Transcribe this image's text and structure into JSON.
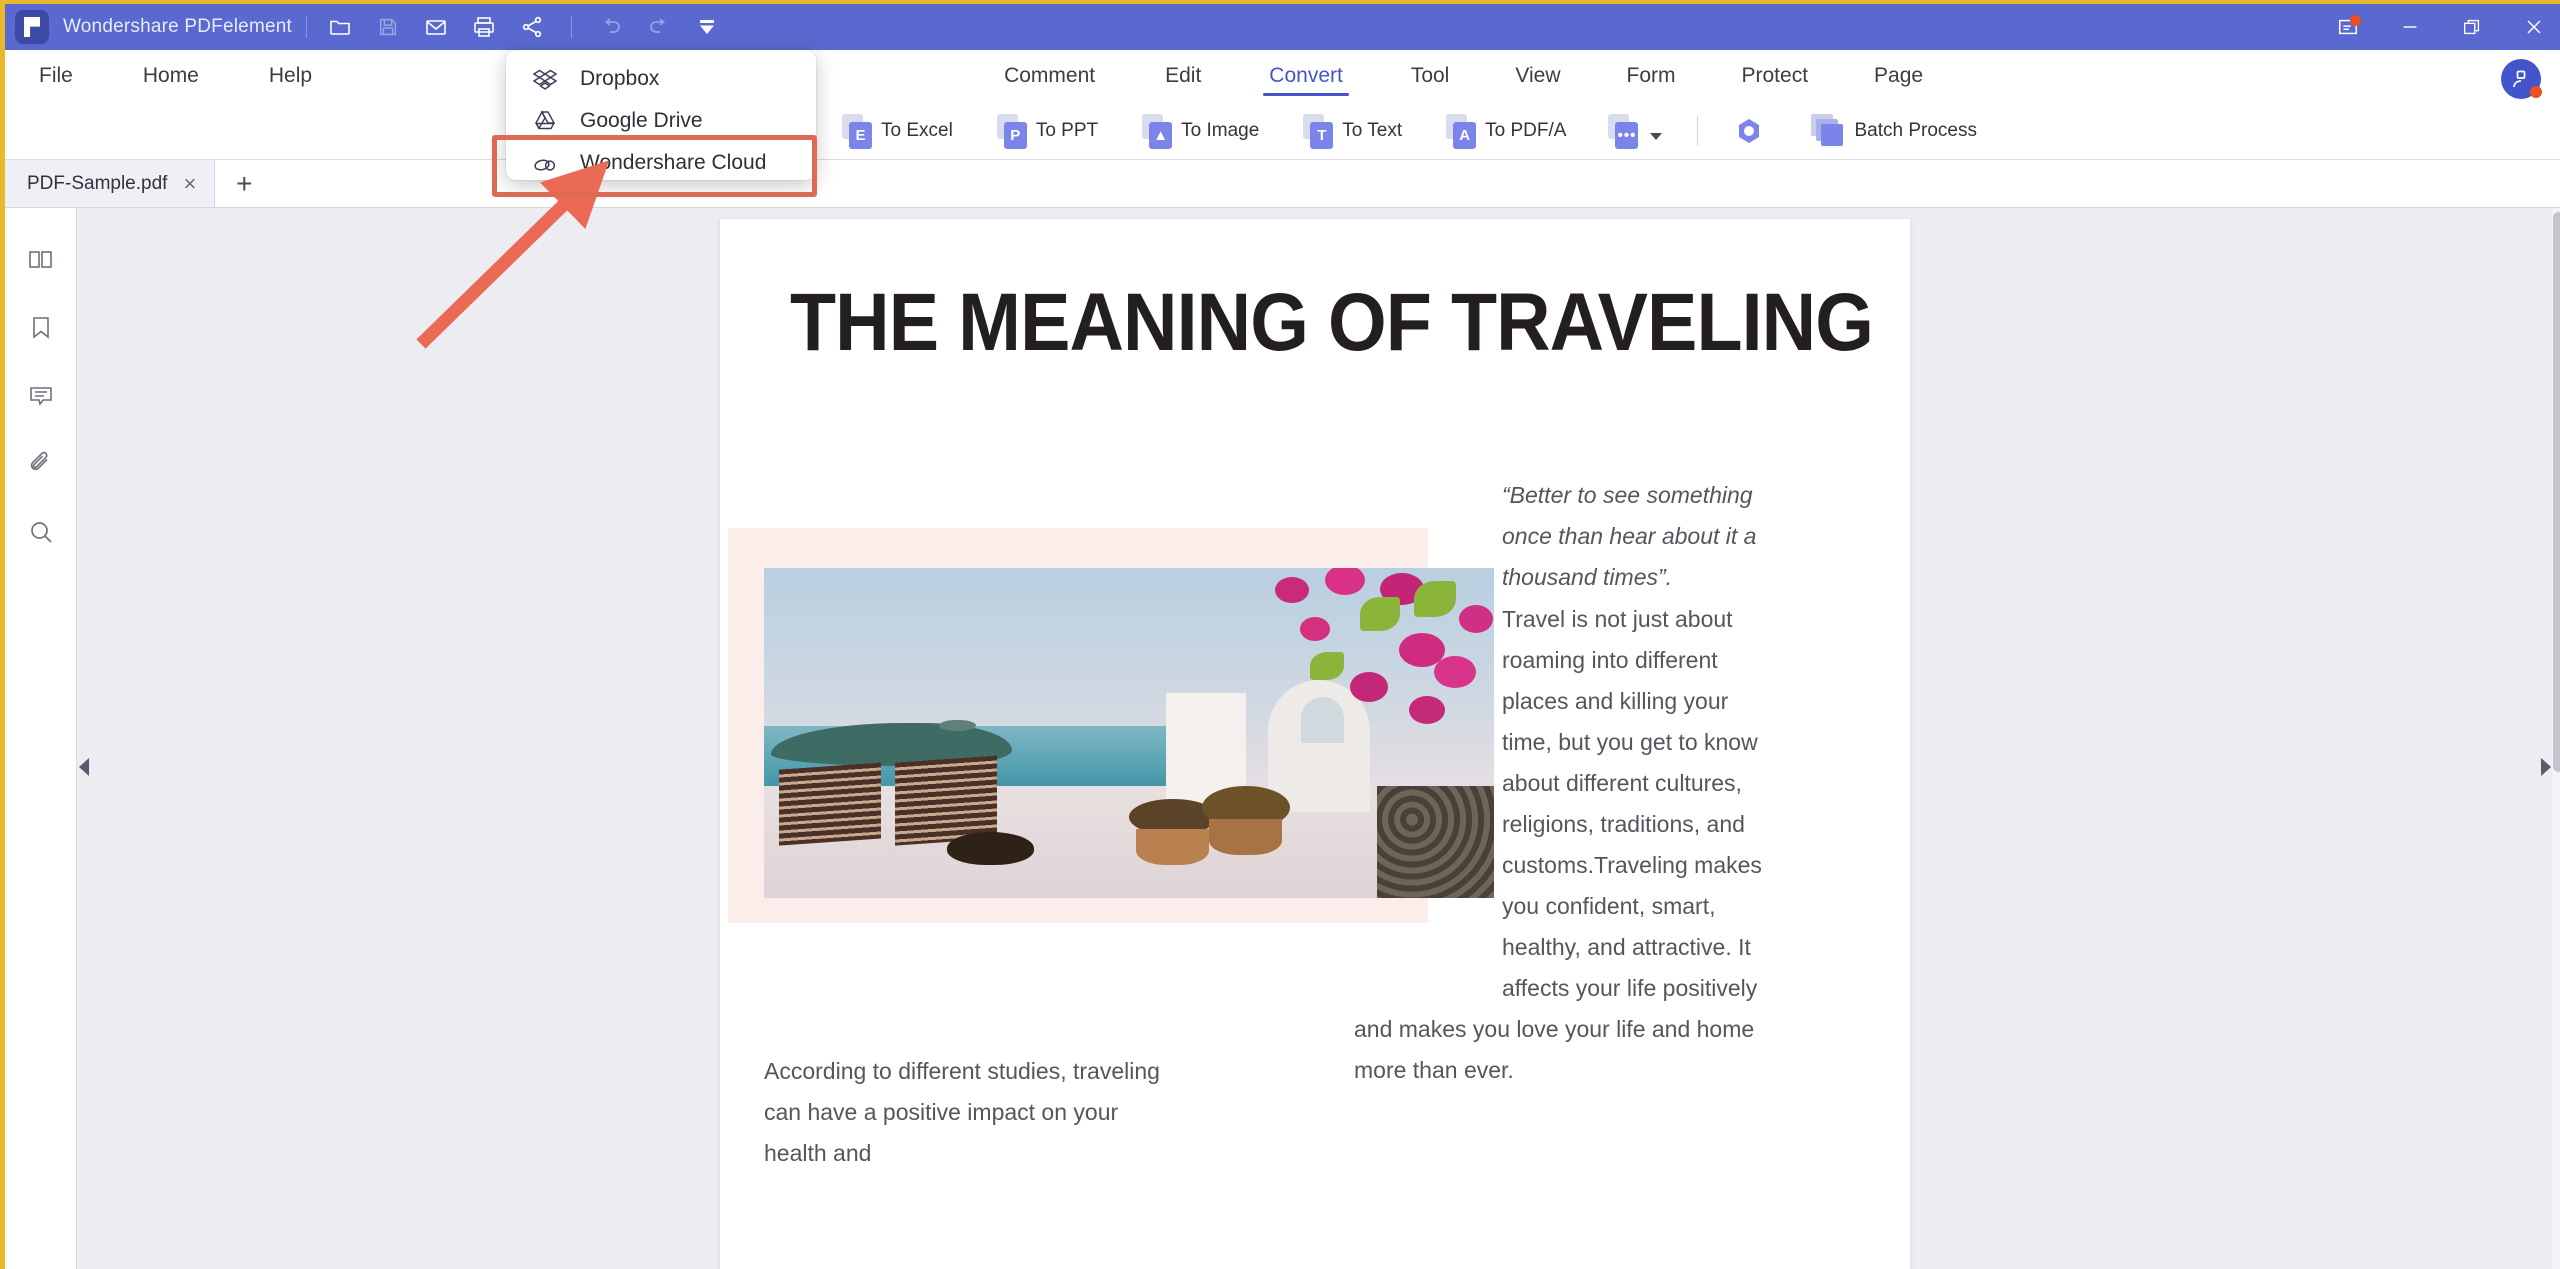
{
  "titlebar": {
    "app_name": "Wondershare PDFelement",
    "brand_color": "#5969cf",
    "accent_color": "#e8b92a",
    "quick_tools": [
      {
        "name": "open-folder-icon",
        "label": "Open"
      },
      {
        "name": "save-icon",
        "label": "Save"
      },
      {
        "name": "email-icon",
        "label": "Email"
      },
      {
        "name": "print-icon",
        "label": "Print"
      },
      {
        "name": "share-icon",
        "label": "Share"
      },
      {
        "name": "undo-icon",
        "label": "Undo"
      },
      {
        "name": "redo-icon",
        "label": "Redo"
      },
      {
        "name": "customize-icon",
        "label": "Customize Quick Access Toolbar"
      }
    ],
    "window_controls": [
      {
        "name": "notifications-icon",
        "label": "Notifications",
        "badge": true
      },
      {
        "name": "minimize-icon",
        "label": "Minimize"
      },
      {
        "name": "restore-icon",
        "label": "Restore"
      },
      {
        "name": "close-icon",
        "label": "Close"
      }
    ]
  },
  "ribbon": {
    "tabs": [
      {
        "label": "File",
        "active": false
      },
      {
        "label": "Home",
        "active": false
      },
      {
        "label": "Help",
        "active": false
      },
      {
        "label": "Comment",
        "active": false
      },
      {
        "label": "Edit",
        "active": false
      },
      {
        "label": "Convert",
        "active": true
      },
      {
        "label": "Tool",
        "active": false
      },
      {
        "label": "View",
        "active": false
      },
      {
        "label": "Form",
        "active": false
      },
      {
        "label": "Protect",
        "active": false
      },
      {
        "label": "Page",
        "active": false
      }
    ],
    "active_tab": "Convert",
    "active_color": "#4455cc",
    "account": {
      "name": "account-avatar",
      "label": "Account"
    }
  },
  "toolbar": {
    "buttons": [
      {
        "label": "To Excel",
        "glyph": "E",
        "icon": "to-excel-icon"
      },
      {
        "label": "To PPT",
        "glyph": "P",
        "icon": "to-ppt-icon"
      },
      {
        "label": "To Image",
        "glyph": "▲",
        "icon": "to-image-icon"
      },
      {
        "label": "To Text",
        "glyph": "T",
        "icon": "to-text-icon"
      },
      {
        "label": "To PDF/A",
        "glyph": "A",
        "icon": "to-pdfa-icon"
      }
    ],
    "more_button": {
      "label": "More conversions",
      "glyph": "•••",
      "icon": "more-convert-icon"
    },
    "ocr_button": {
      "label": "OCR",
      "icon": "ocr-icon"
    },
    "batch_button": {
      "label": "Batch Process",
      "icon": "batch-process-icon"
    }
  },
  "tabstrip": {
    "documents": [
      {
        "name": "PDF-Sample.pdf",
        "active": true
      }
    ],
    "close_label": "×",
    "add_label": "+"
  },
  "left_rail": {
    "items": [
      {
        "name": "thumbnails-panel-icon",
        "label": "Thumbnails"
      },
      {
        "name": "bookmark-panel-icon",
        "label": "Bookmarks"
      },
      {
        "name": "comment-panel-icon",
        "label": "Comments"
      },
      {
        "name": "attachment-panel-icon",
        "label": "Attachments"
      },
      {
        "name": "search-panel-icon",
        "label": "Search"
      }
    ]
  },
  "dropdown": {
    "visible": true,
    "items": [
      {
        "label": "Dropbox",
        "icon": "dropbox-icon",
        "highlighted": false
      },
      {
        "label": "Google Drive",
        "icon": "google-drive-icon",
        "highlighted": false
      },
      {
        "label": "Wondershare Cloud",
        "icon": "wondershare-cloud-icon",
        "highlighted": true
      }
    ]
  },
  "annotations": {
    "highlight_color": "#dd6a54",
    "arrow_color": "#ea6a55",
    "highlight_target": "Wondershare Cloud",
    "arrow_points_to": "Wondershare Cloud"
  },
  "document": {
    "title": "THE MEANING OF TRAVELING",
    "quote": "“Better to see something once than hear about it a thousand times”.",
    "paragraph_1_narrow": "Travel is not just about roaming into different places and killing your time, but you get to know about different cultures, religions, traditions, and customs.Traveling makes you confident, smart, healthy, and attractive. It affects your life positively",
    "paragraph_1_wide": "and makes you love your life and home more than ever.",
    "paragraph_2": "According to different studies, traveling can have a positive impact on your health and",
    "photo_alt": "Santorini terrace overlooking the sea with chairs, potted plants and bougainvillea"
  },
  "viewer": {
    "scroll_thumb": "vertical-scrollbar-thumb",
    "collapse_left": "collapse-left-panel",
    "collapse_right": "collapse-right-panel"
  }
}
